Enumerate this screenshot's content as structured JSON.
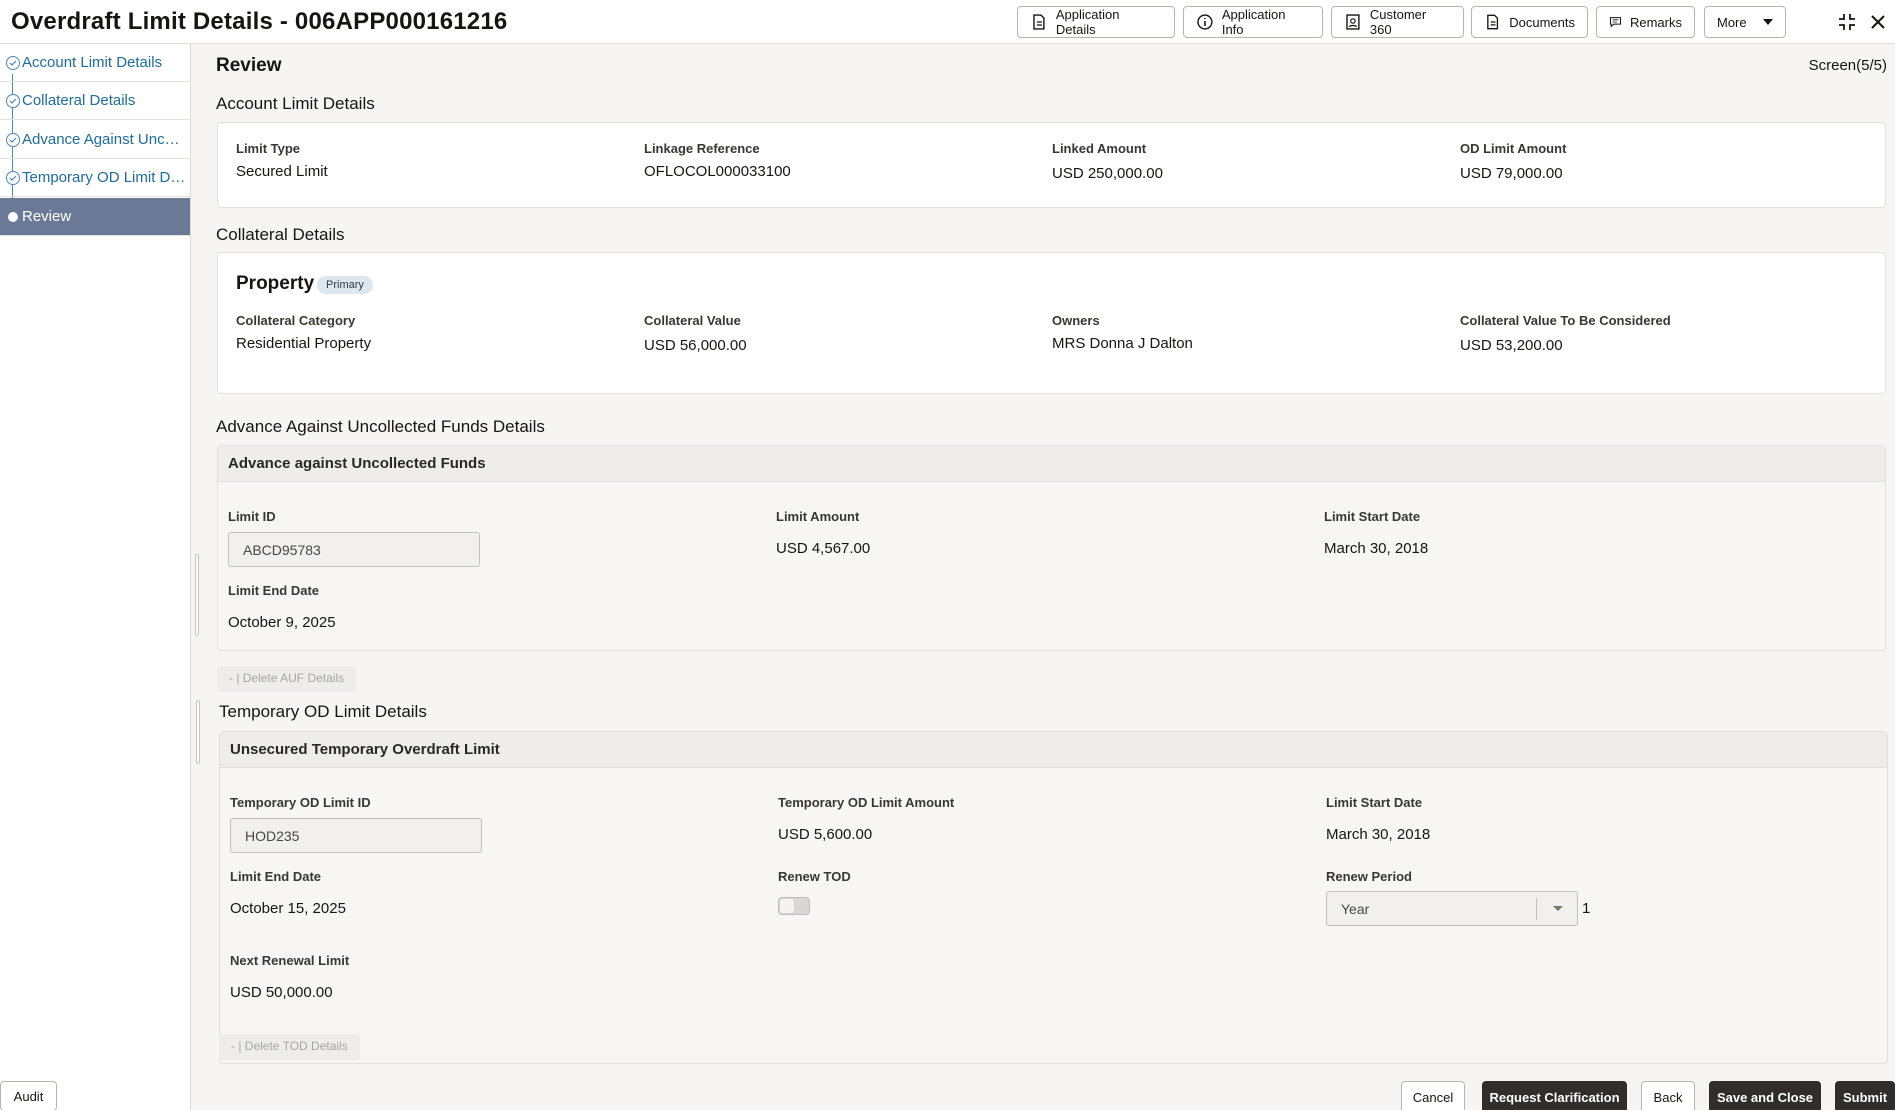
{
  "header": {
    "title": "Overdraft Limit Details - 006APP000161216",
    "buttons": [
      "Application Details",
      "Application Info",
      "Customer 360",
      "Documents",
      "Remarks",
      "More"
    ]
  },
  "sidebar": {
    "steps": [
      {
        "label": "Account Limit Details",
        "state": "done"
      },
      {
        "label": "Collateral Details",
        "state": "done"
      },
      {
        "label": "Advance Against Uncollected Funds Details",
        "state": "done"
      },
      {
        "label": "Temporary OD Limit Details",
        "state": "done"
      },
      {
        "label": "Review",
        "state": "active"
      }
    ]
  },
  "main": {
    "title": "Review",
    "screen": "Screen(5/5)",
    "account": {
      "title": "Account Limit Details",
      "fields": [
        {
          "label": "Limit Type",
          "value": "Secured Limit"
        },
        {
          "label": "Linkage Reference",
          "value": "OFLOCOL000033100"
        },
        {
          "label": "Linked Amount",
          "value": "USD 250,000.00"
        },
        {
          "label": "OD Limit Amount",
          "value": "USD 79,000.00"
        }
      ]
    },
    "collateral": {
      "title": "Collateral Details",
      "name": "Property",
      "badge": "Primary",
      "fields": [
        {
          "label": "Collateral Category",
          "value": "Residential Property"
        },
        {
          "label": "Collateral Value",
          "value": "USD 56,000.00"
        },
        {
          "label": "Owners",
          "value": "MRS Donna J Dalton"
        },
        {
          "label": "Collateral Value To Be Considered",
          "value": "USD 53,200.00"
        }
      ]
    },
    "auf": {
      "title": "Advance Against Uncollected Funds Details",
      "card_title": "Advance against Uncollected Funds",
      "limit_id_label": "Limit ID",
      "limit_id": "ABCD95783",
      "limit_amount_label": "Limit Amount",
      "limit_amount": "USD 4,567.00",
      "start_label": "Limit Start Date",
      "start": "March 30, 2018",
      "end_label": "Limit End Date",
      "end": "October 9, 2025",
      "delete_label": "- | Delete AUF Details"
    },
    "tod": {
      "title": "Temporary OD Limit Details",
      "card_title": "Unsecured Temporary Overdraft Limit",
      "id_label": "Temporary OD Limit ID",
      "id": "HOD235",
      "amount_label": "Temporary OD Limit Amount",
      "amount": "USD 5,600.00",
      "start_label": "Limit Start Date",
      "start": "March 30, 2018",
      "end_label": "Limit End Date",
      "end": "October 15, 2025",
      "renew_label": "Renew TOD",
      "renew_on": false,
      "period_label": "Renew Period",
      "period": "Year",
      "period_count": "1",
      "next_label": "Next Renewal Limit",
      "next": "USD 50,000.00",
      "delete_label": "- | Delete TOD Details"
    }
  },
  "footer": {
    "audit": "Audit",
    "cancel": "Cancel",
    "request": "Request Clarification",
    "back": "Back",
    "save": "Save and Close",
    "submit": "Submit"
  },
  "colors": {
    "accent": "#1f6b9a",
    "active_step": "#6a7a96",
    "primary_button": "#312d2a"
  }
}
